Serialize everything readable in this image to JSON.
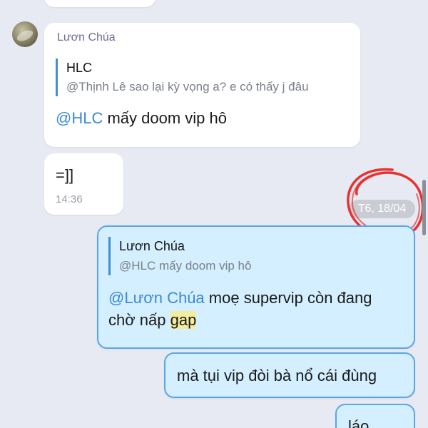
{
  "incoming": {
    "sender_name": "Lươn Chúa",
    "quote_name": "HLC",
    "quote_text": "@Thịnh Lê sao lại kỳ vọng a? e có thấy j đâu",
    "mention": "@HLC",
    "text": " mấy doom vip hô"
  },
  "incoming_second": {
    "text": "=]]",
    "time": "14:36"
  },
  "date_separator": "T6, 18/04",
  "outgoing_reply": {
    "quote_name": "Lươn Chúa",
    "quote_text": "@HLC mấy doom vip hô",
    "mention": "@Lươn Chúa",
    "text_part1": " moẹ supervip còn đang",
    "text_part2": "chờ nấp ",
    "highlighted": "gap"
  },
  "outgoing_second": {
    "text": "mà tụi vip đòi bà nổ cái đùng"
  },
  "outgoing_third": {
    "text": "láo"
  },
  "colors": {
    "background": "#e7eaf3",
    "incoming_bubble": "#ffffff",
    "outgoing_bubble": "#d4efff",
    "outgoing_border": "#5aa7e6",
    "mention": "#3b8ad2",
    "annotation_circle": "#e8312f"
  }
}
